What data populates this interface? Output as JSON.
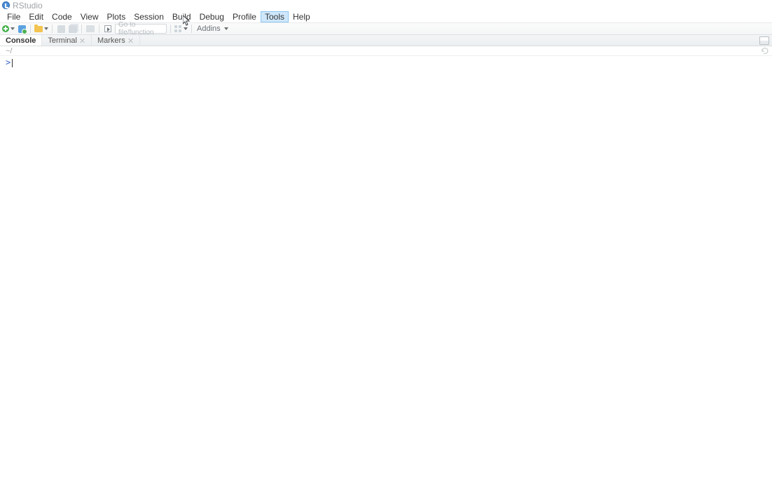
{
  "window": {
    "title": "RStudio"
  },
  "menu": {
    "items": [
      "File",
      "Edit",
      "Code",
      "View",
      "Plots",
      "Session",
      "Build",
      "Debug",
      "Profile",
      "Tools",
      "Help"
    ],
    "hovered_index": 9
  },
  "toolbar": {
    "goto_placeholder": "Go to file/function",
    "addins_label": "Addins"
  },
  "pane": {
    "tabs": [
      {
        "label": "Console",
        "closable": false
      },
      {
        "label": "Terminal",
        "closable": true
      },
      {
        "label": "Markers",
        "closable": true
      }
    ],
    "active_tab_index": 0
  },
  "console": {
    "path_display": "~/",
    "prompt": ">"
  }
}
